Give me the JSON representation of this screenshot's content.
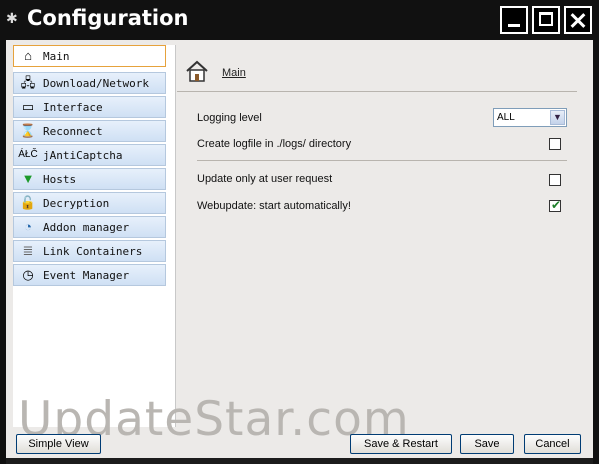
{
  "window": {
    "title": "Configuration",
    "controls": {
      "minimize": "minimize",
      "maximize": "maximize",
      "close": "close"
    }
  },
  "sidebar": {
    "items": [
      {
        "label": "Main",
        "icon": "home-icon",
        "active": true
      },
      {
        "label": "Download/Network",
        "icon": "network-icon"
      },
      {
        "label": "Interface",
        "icon": "window-icon"
      },
      {
        "label": "Reconnect",
        "icon": "hourglass-icon"
      },
      {
        "label": "jAntiCaptcha",
        "icon_text": "ÁŁČ",
        "icon": "captcha-icon"
      },
      {
        "label": "Hosts",
        "icon": "down-arrow-icon"
      },
      {
        "label": "Decryption",
        "icon": "lock-icon"
      },
      {
        "label": "Addon manager",
        "icon": "addon-icon"
      },
      {
        "label": "Link Containers",
        "icon": "database-icon"
      },
      {
        "label": "Event Manager",
        "icon": "clock-icon"
      }
    ]
  },
  "panel": {
    "breadcrumb": "Main",
    "settings": [
      {
        "label": "Logging level",
        "control": "select",
        "value": "ALL"
      },
      {
        "label": "Create logfile in ./logs/ directory",
        "control": "checkbox",
        "checked": false
      },
      {
        "label": "Update only at user request",
        "control": "checkbox",
        "checked": false
      },
      {
        "label": "Webupdate:  start automatically!",
        "control": "checkbox",
        "checked": true
      }
    ]
  },
  "buttons": {
    "simple_view": "Simple View",
    "save_restart": "Save & Restart",
    "save": "Save",
    "cancel": "Cancel"
  },
  "watermark": "UpdateStar.com"
}
